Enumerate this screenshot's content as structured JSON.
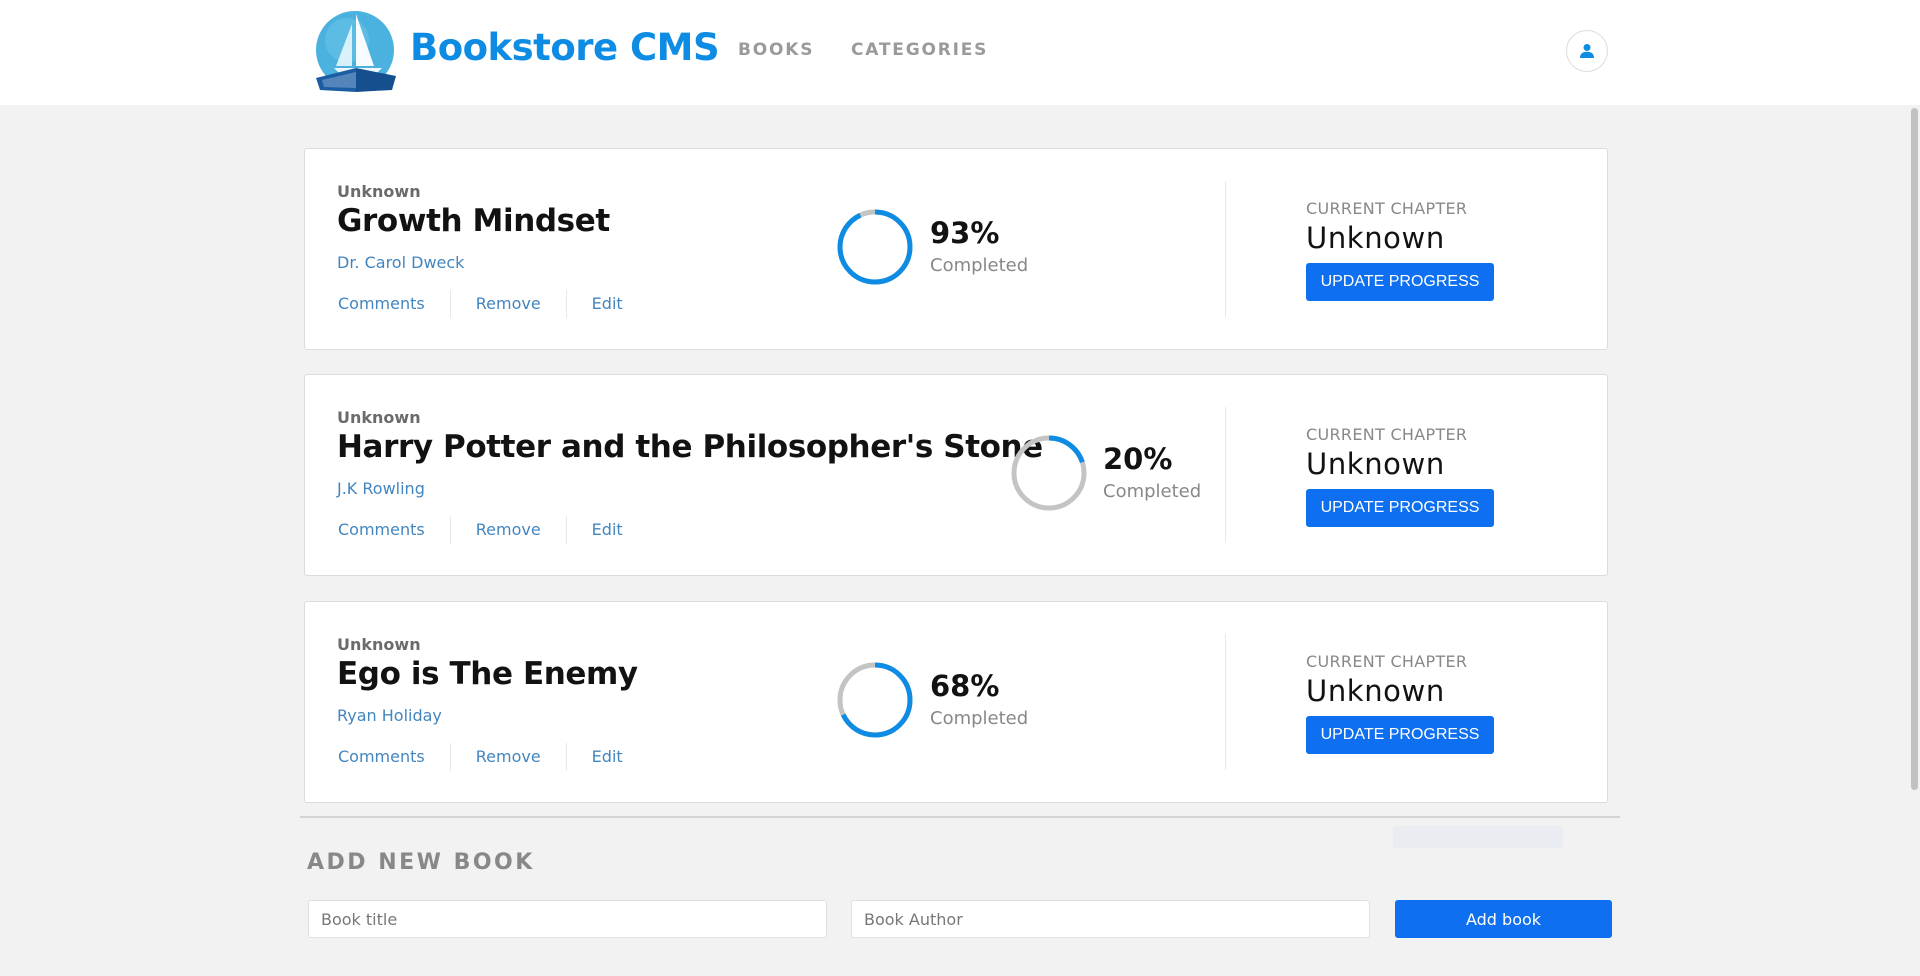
{
  "header": {
    "brand": "Bookstore CMS",
    "nav": [
      {
        "label": "BOOKS"
      },
      {
        "label": "CATEGORIES"
      }
    ],
    "icons": {
      "logo": "book-sailboat-logo",
      "user": "user-icon"
    },
    "accent_color": "#0e8ce4"
  },
  "labels": {
    "current_chapter": "CURRENT CHAPTER",
    "completed": "Completed",
    "update_button": "UPDATE PROGRESS",
    "actions": [
      "Comments",
      "Remove",
      "Edit"
    ]
  },
  "books": [
    {
      "genre": "Unknown",
      "title": "Growth Mindset",
      "author": "Dr. Carol Dweck",
      "progress": 93,
      "percent_label": "93%",
      "chapter": "Unknown"
    },
    {
      "genre": "Unknown",
      "title": "Harry Potter and the Philosopher's Stone",
      "author": "J.K Rowling",
      "progress": 20,
      "percent_label": "20%",
      "chapter": "Unknown"
    },
    {
      "genre": "Unknown",
      "title": "Ego is The Enemy",
      "author": "Ryan Holiday",
      "progress": 68,
      "percent_label": "68%",
      "chapter": "Unknown"
    }
  ],
  "form": {
    "title": "ADD NEW BOOK",
    "title_placeholder": "Book title",
    "author_placeholder": "Book Author",
    "submit_label": "Add book"
  },
  "colors": {
    "progress_fill": "#0e8ce4",
    "progress_track": "#c4c4c4",
    "button": "#0e6ff0"
  }
}
